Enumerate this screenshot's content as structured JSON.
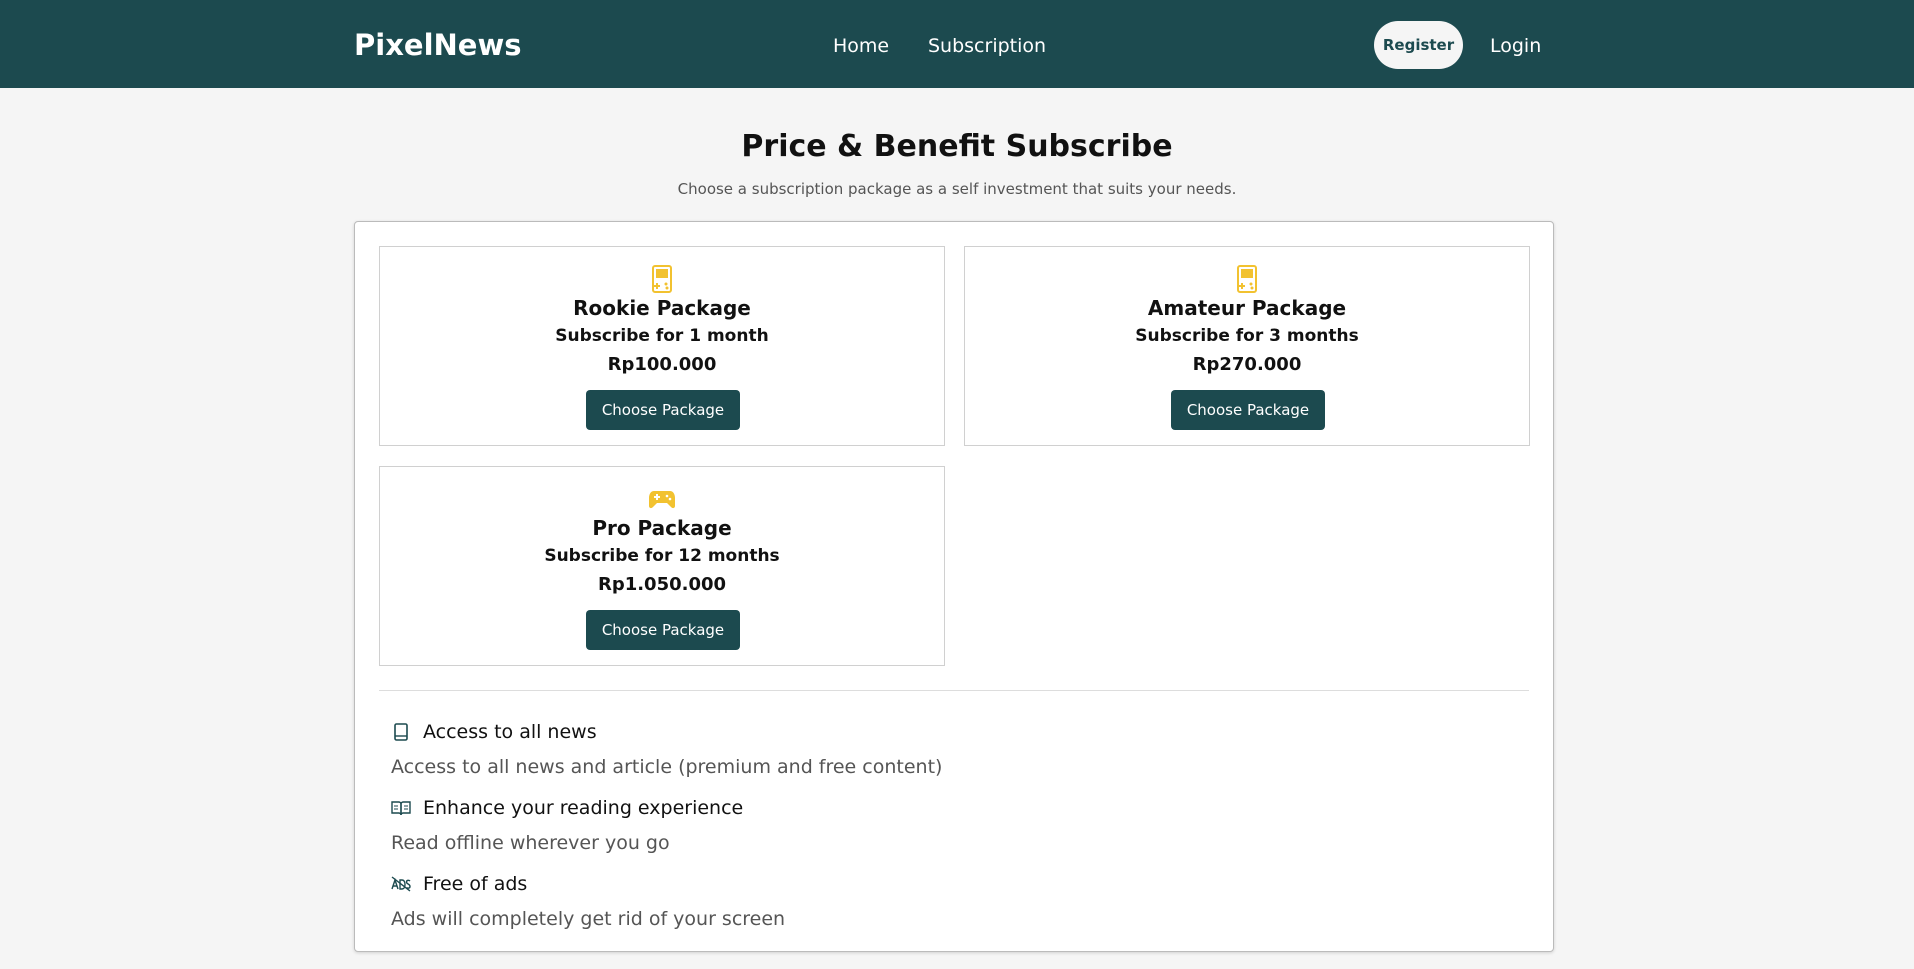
{
  "header": {
    "brand": "PixelNews",
    "nav": {
      "home": "Home",
      "subscription": "Subscription"
    },
    "register_label": "Register",
    "login_label": "Login",
    "colors": {
      "bar": "#1c4a4f",
      "register_bg": "#f5f5f5"
    }
  },
  "main": {
    "title": "Price & Benefit Subscribe",
    "subtitle": "Choose a subscription package as a self investment that suits your needs."
  },
  "packages": [
    {
      "icon": "handheld-console-icon",
      "name": "Rookie Package",
      "duration": "Subscribe for 1 month",
      "price": "Rp100.000",
      "button": "Choose Package"
    },
    {
      "icon": "handheld-console-icon",
      "name": "Amateur Package",
      "duration": "Subscribe for 3 months",
      "price": "Rp270.000",
      "button": "Choose Package"
    },
    {
      "icon": "gamepad-icon",
      "name": "Pro Package",
      "duration": "Subscribe for 12 months",
      "price": "Rp1.050.000",
      "button": "Choose Package"
    }
  ],
  "benefits": [
    {
      "icon": "book-icon",
      "title": "Access to all news",
      "description": "Access to all news and article (premium and free content)"
    },
    {
      "icon": "open-book-icon",
      "title": "Enhance your reading experience",
      "description": "Read offline wherever you go"
    },
    {
      "icon": "ads-off-icon",
      "title": "Free of ads",
      "description": "Ads will completely get rid of your screen"
    }
  ],
  "colors": {
    "accent": "#1c4a4f",
    "icon_yellow": "#f2c230"
  }
}
